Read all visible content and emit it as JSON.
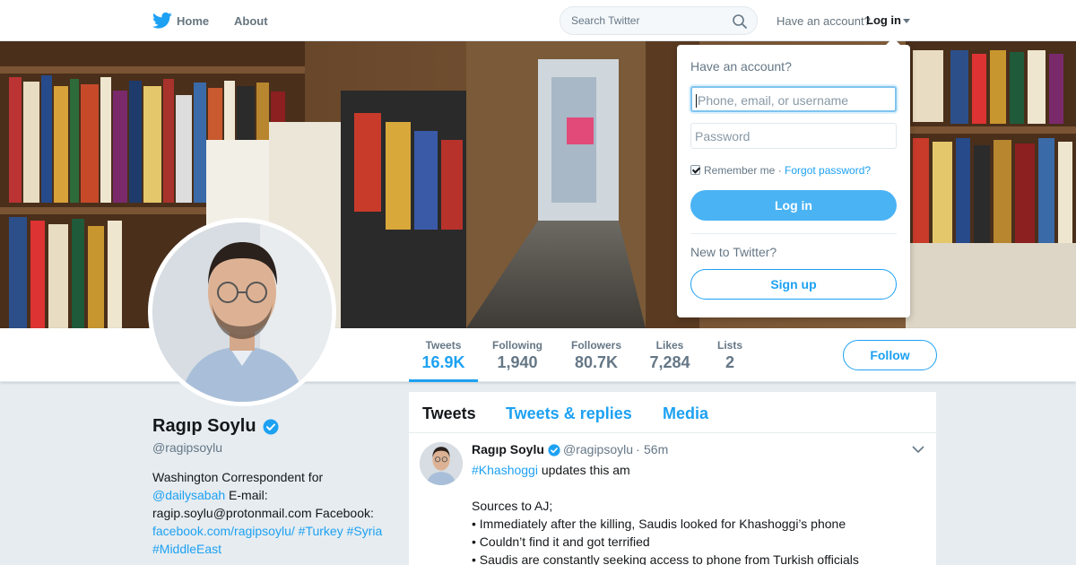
{
  "nav": {
    "home_label": "Home",
    "about_label": "About",
    "search_placeholder": "Search Twitter",
    "have_account": "Have an account?",
    "login_label": "Log in",
    "icons": {
      "logo": "twitter-bird-icon",
      "search": "search-icon",
      "caret": "caret-down-icon"
    }
  },
  "profile": {
    "name": "Ragıp Soylu",
    "handle": "@ragipsoylu",
    "bio": {
      "part1": "Washington Correspondent for ",
      "link1": "@dailysabah",
      "part2": " E-mail: ragip.soylu@protonmail.com Facebook: ",
      "link2": "facebook.com/ragipsoylu/",
      "space": " ",
      "tag1": "#Turkey",
      "tag2": "#Syria",
      "tag3": "#MiddleEast"
    }
  },
  "stats": [
    {
      "label": "Tweets",
      "value": "16.9K"
    },
    {
      "label": "Following",
      "value": "1,940"
    },
    {
      "label": "Followers",
      "value": "80.7K"
    },
    {
      "label": "Likes",
      "value": "7,284"
    },
    {
      "label": "Lists",
      "value": "2"
    }
  ],
  "follow_label": "Follow",
  "timeline": {
    "tabs": [
      "Tweets",
      "Tweets & replies",
      "Media"
    ],
    "tweet": {
      "name": "Ragıp Soylu",
      "handle": "@ragipsoylu",
      "dot": "·",
      "time": "56m",
      "hashtag": "#Khashoggi",
      "line1": " updates this am",
      "line2": "Sources to AJ;",
      "line3": "• Immediately after the killing, Saudis looked for Khashoggi’s phone",
      "line4": "• Couldn’t find it and got terrified",
      "line5": "• Saudis are constantly seeking access to phone from Turkish officials"
    }
  },
  "login_dropdown": {
    "title": "Have an account?",
    "username_placeholder": "Phone, email, or username",
    "password_placeholder": "Password",
    "remember": "Remember me",
    "separator": " · ",
    "forgot": "Forgot password?",
    "login_button": "Log in",
    "new_to_twitter": "New to Twitter?",
    "signup_button": "Sign up"
  },
  "colors": {
    "accent": "#1da1f2",
    "login_button": "#4ab3f4",
    "background": "#e6ecf0"
  }
}
